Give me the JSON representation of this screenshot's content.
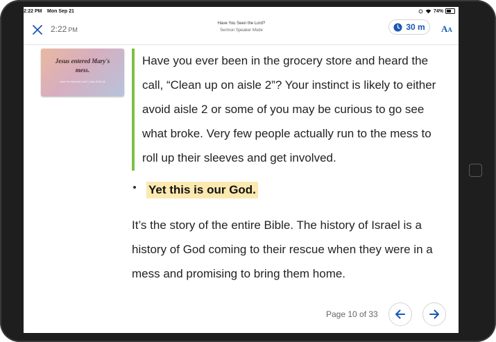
{
  "status_bar": {
    "time": "2:22 PM",
    "date": "Mon Sep 21",
    "battery": "74%",
    "battery_level": 0.74
  },
  "header": {
    "time": "2:22",
    "ampm": "PM",
    "title": "Have You Seen the Lord?",
    "subtitle": "Sermon Speaker Mode",
    "timer_label": "30 m",
    "font_big": "A",
    "font_small": "A"
  },
  "slide": {
    "title_line1": "Jesus entered Mary's",
    "title_line2": "mess.",
    "reference": "Have You Seen the Lord? | John 20:10-18"
  },
  "content": {
    "quote": "Have you ever been in the grocery store and heard the call, “Clean up on aisle 2”? Your instinct is likely to either avoid aisle 2 or some of you may be curious to go see what broke. Very few people actually run to the mess to roll up their sleeves and get involved.",
    "bullet": "Yet this is our God.",
    "paragraph": "It’s the story of the entire Bible. The history of Israel is a history of God coming to their rescue when they were in a mess and promising to bring them home."
  },
  "footer": {
    "page_indicator": "Page 10 of 33"
  },
  "colors": {
    "accent": "#1a57b5",
    "quote_bar": "#7bc043",
    "highlight": "#fbe9b0"
  },
  "icons": {
    "close": "close-icon",
    "clock": "clock-icon",
    "prev": "arrow-left-icon",
    "next": "arrow-right-icon"
  }
}
